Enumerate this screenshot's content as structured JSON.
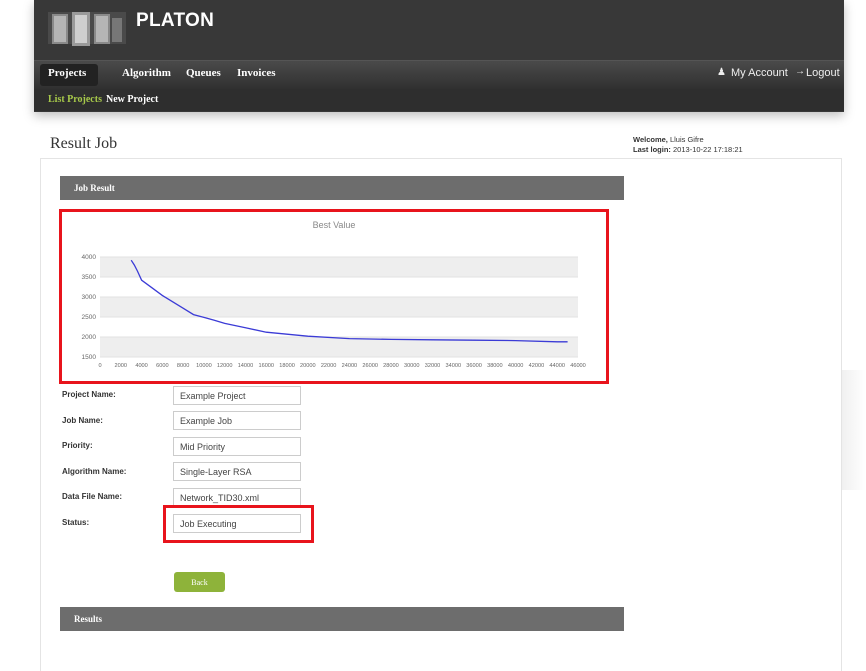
{
  "app": {
    "brand": "PLATON",
    "logo_icon": "server-rack-icon"
  },
  "nav": {
    "items": [
      "Projects",
      "Algorithm",
      "Queues",
      "Invoices"
    ],
    "my_account": "My Account",
    "logout": "Logout"
  },
  "subnav": {
    "items": [
      "List Projects",
      "New Project"
    ]
  },
  "page": {
    "title": "Result Job"
  },
  "welcome": {
    "welcome_label": "Welcome,",
    "user": "Lluis Gifre",
    "last_login_label": "Last login:",
    "last_login": "2013-10-22 17:18:21"
  },
  "job_result": {
    "header": "Job Result"
  },
  "form": {
    "project_name_label": "Project Name:",
    "project_name": "Example Project",
    "job_name_label": "Job Name:",
    "job_name": "Example Job",
    "priority_label": "Priority:",
    "priority": "Mid Priority",
    "algorithm_label": "Algorithm Name:",
    "algorithm": "Single-Layer RSA",
    "data_file_label": "Data File Name:",
    "data_file": "Network_TID30.xml",
    "status_label": "Status:",
    "status": "Job Executing"
  },
  "buttons": {
    "back": "Back"
  },
  "results": {
    "header": "Results"
  },
  "colors": {
    "accent": "#8eb33a",
    "line": "#3b3bd6",
    "highlight": "#e8141c",
    "header_bg": "#6d6d6d"
  },
  "chart_data": {
    "type": "line",
    "title": "Best Value",
    "xlabel": "",
    "ylabel": "",
    "xlim": [
      0,
      46000
    ],
    "ylim": [
      1500,
      4000
    ],
    "x_ticks": [
      0,
      2000,
      4000,
      6000,
      8000,
      10000,
      12000,
      14000,
      16000,
      18000,
      20000,
      22000,
      24000,
      26000,
      28000,
      30000,
      32000,
      34000,
      36000,
      38000,
      40000,
      42000,
      44000,
      46000
    ],
    "y_ticks": [
      1500,
      2000,
      2500,
      3000,
      3500,
      4000
    ],
    "grid": "horizontal bands",
    "series": [
      {
        "x": [
          3000,
          3300,
          3600,
          4000,
          5000,
          6000,
          7000,
          8000,
          9000,
          10000,
          11000,
          12000,
          14000,
          16000,
          18000,
          20000,
          24000,
          28000,
          32000,
          36000,
          40000,
          44000,
          45000
        ],
        "values": [
          3920,
          3800,
          3650,
          3420,
          3230,
          3040,
          2880,
          2720,
          2560,
          2490,
          2420,
          2340,
          2230,
          2120,
          2070,
          2020,
          1960,
          1940,
          1930,
          1920,
          1910,
          1880,
          1880
        ]
      }
    ]
  }
}
